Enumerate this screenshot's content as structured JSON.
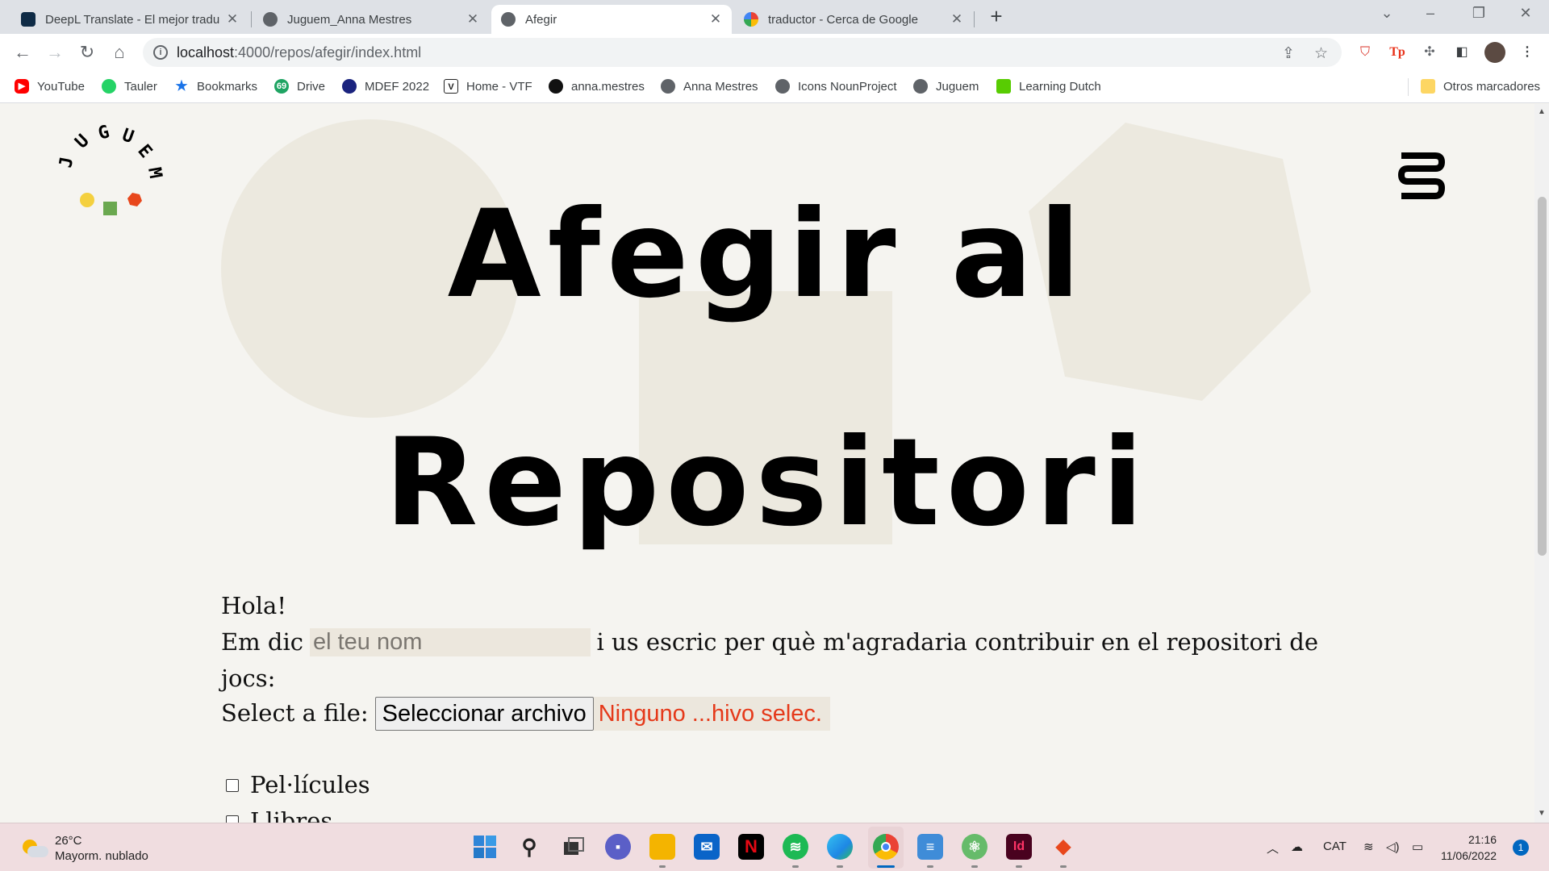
{
  "browser": {
    "tabs": [
      {
        "title": "DeepL Translate - El mejor traduc",
        "favicon": "deepl-icon",
        "color": "#0f2b46",
        "active": false
      },
      {
        "title": "Juguem_Anna Mestres",
        "favicon": "globe-icon",
        "color": "#5f6368",
        "active": false
      },
      {
        "title": "Afegir",
        "favicon": "globe-icon",
        "color": "#5f6368",
        "active": true
      },
      {
        "title": "traductor - Cerca de Google",
        "favicon": "google-icon",
        "color": "#4285f4",
        "active": false
      }
    ],
    "new_tab": "+",
    "url_host": "localhost",
    "url_path": ":4000/repos/afegir/index.html",
    "bookmarks": [
      {
        "label": "YouTube",
        "icon": "youtube-icon",
        "color": "#ff0000"
      },
      {
        "label": "Tauler",
        "icon": "whatsapp-icon",
        "color": "#25d366"
      },
      {
        "label": "Bookmarks",
        "icon": "star-icon",
        "color": "#1a73e8"
      },
      {
        "label": "Drive",
        "icon": "drive-icon",
        "color": "#1fa463"
      },
      {
        "label": "MDEF 2022",
        "icon": "mdef-icon",
        "color": "#1a237e"
      },
      {
        "label": "Home - VTF",
        "icon": "vtf-icon",
        "color": "#222222"
      },
      {
        "label": "anna.mestres",
        "icon": "github-icon",
        "color": "#111111"
      },
      {
        "label": "Anna Mestres",
        "icon": "globe-icon",
        "color": "#5f6368"
      },
      {
        "label": "Icons NounProject",
        "icon": "globe-icon",
        "color": "#5f6368"
      },
      {
        "label": "Juguem",
        "icon": "globe-icon",
        "color": "#5f6368"
      },
      {
        "label": "Learning Dutch",
        "icon": "duolingo-icon",
        "color": "#58cc02"
      }
    ],
    "other_bookmarks": "Otros marcadores"
  },
  "page": {
    "logo_text": "JUGUEM",
    "logo_colors": [
      "#f4d03f",
      "#6aa84f",
      "#e8471c"
    ],
    "hero_line1": "Afegir al",
    "hero_line2": "Repositori",
    "greeting": "Hola!",
    "name_prefix": "Em dic",
    "name_placeholder": "el teu nom",
    "name_suffix": "i us escric per què m'agradaria contribuir en el repositori de",
    "name_suffix2": "jocs:",
    "file_label": "Select a file:",
    "file_button": "Seleccionar archivo",
    "file_status": "Ninguno ...hivo selec.",
    "checkbox1": "Pel·lícules",
    "checkbox2": "Llibres",
    "accent_color": "#e5391a",
    "background_color": "#f5f4f0",
    "shape_color": "#ece9df"
  },
  "taskbar": {
    "temperature": "26°C",
    "weather": "Mayorm. nublado",
    "language": "CAT",
    "time": "21:16",
    "date": "11/06/2022",
    "notifications": "1",
    "apps": [
      {
        "name": "windows-start-icon",
        "color": "#2d7fd3"
      },
      {
        "name": "search-icon",
        "color": "#222222"
      },
      {
        "name": "task-view-icon",
        "color": "#333333"
      },
      {
        "name": "teams-chat-icon",
        "color": "#5b5fc7"
      },
      {
        "name": "file-explorer-icon",
        "color": "#f4b400"
      },
      {
        "name": "mail-icon",
        "color": "#0a64c8"
      },
      {
        "name": "netflix-icon",
        "color": "#000000"
      },
      {
        "name": "spotify-icon",
        "color": "#1db954"
      },
      {
        "name": "edge-icon",
        "color": "#1e88e5"
      },
      {
        "name": "chrome-icon",
        "color": "#ffffff"
      },
      {
        "name": "notepad-icon",
        "color": "#3f8cd8"
      },
      {
        "name": "atom-icon",
        "color": "#66bb6a"
      },
      {
        "name": "indesign-icon",
        "color": "#49021f"
      },
      {
        "name": "gitkraken-icon",
        "color": "#f5f5f5"
      }
    ]
  }
}
